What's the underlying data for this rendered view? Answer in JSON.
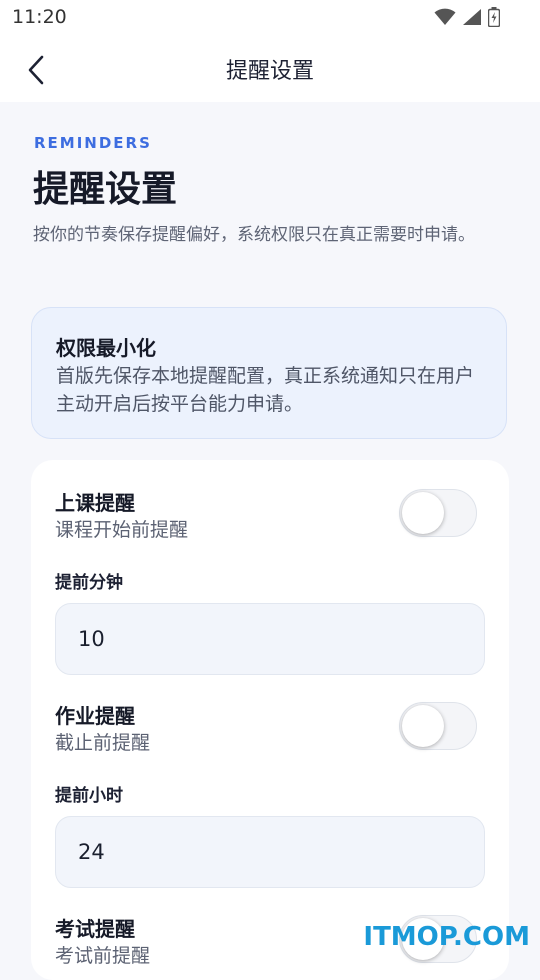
{
  "status_bar": {
    "time": "11:20",
    "icons": [
      "wifi-icon",
      "signal-icon",
      "battery-charging-icon"
    ]
  },
  "app_bar": {
    "back_icon": "chevron-left-icon",
    "title": "提醒设置"
  },
  "header": {
    "eyebrow": "REMINDERS",
    "title": "提醒设置",
    "subtitle": "按你的节奏保存提醒偏好，系统权限只在真正需要时申请。"
  },
  "info_card": {
    "title": "权限最小化",
    "body": "首版先保存本地提醒配置，真正系统通知只在用户主动开启后按平台能力申请。"
  },
  "settings": {
    "class_reminder": {
      "title": "上课提醒",
      "description": "课程开始前提醒",
      "enabled": false,
      "field_label": "提前分钟",
      "value": "10"
    },
    "homework_reminder": {
      "title": "作业提醒",
      "description": "截止前提醒",
      "enabled": false,
      "field_label": "提前小时",
      "value": "24"
    },
    "exam_reminder": {
      "title": "考试提醒",
      "description": "考试前提醒",
      "enabled": false
    }
  },
  "watermark": "ITMOP.COM",
  "colors": {
    "accent": "#3d6de0",
    "background": "#f6f7fb",
    "info_card_bg": "#ecf2fd",
    "watermark": "#1a9ad8"
  }
}
